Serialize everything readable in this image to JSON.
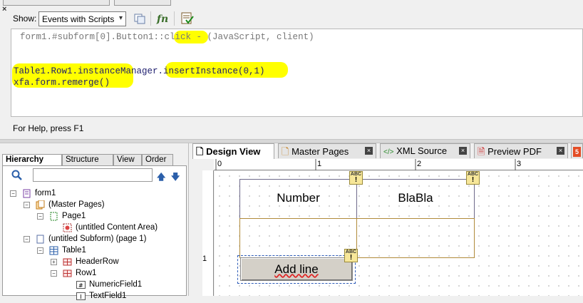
{
  "script_editor": {
    "close_label": "×",
    "show_label": "Show:",
    "show_value": "Events with Scripts",
    "script_header": "form1.#subform[0].Button1::click - (JavaScript, client)",
    "code_lines": [
      "Table1.Row1.instanceManager.insertInstance(0,1)",
      "xfa.form.remerge()"
    ],
    "help_text": "For Help, press F1",
    "highlight_color": "#ffff00"
  },
  "hierarchy_panel": {
    "tabs": [
      "Hierarchy",
      "Structure",
      "View",
      "Order"
    ],
    "tree": [
      {
        "label": "form1",
        "icon": "form-icon",
        "expander": "minus"
      },
      {
        "label": "(Master Pages)",
        "icon": "master-pages-icon",
        "expander": "minus"
      },
      {
        "label": "Page1",
        "icon": "page-icon",
        "expander": "minus"
      },
      {
        "label": "(untitled Content Area)",
        "icon": "content-area-icon",
        "expander": ""
      },
      {
        "label": "(untitled Subform) (page 1)",
        "icon": "subform-icon",
        "expander": "minus"
      },
      {
        "label": "Table1",
        "icon": "table-icon",
        "expander": "minus"
      },
      {
        "label": "HeaderRow",
        "icon": "row-icon",
        "expander": "plus"
      },
      {
        "label": "Row1",
        "icon": "row-icon",
        "expander": "minus"
      },
      {
        "label": "NumericField1",
        "icon": "numeric-field-icon",
        "expander": ""
      },
      {
        "label": "TextField1",
        "icon": "text-field-icon",
        "expander": ""
      }
    ]
  },
  "design_area": {
    "tabs": [
      "Design View",
      "Master Pages",
      "XML Source",
      "Preview PDF"
    ],
    "ruler_labels": [
      "0",
      "1",
      "2",
      "3"
    ],
    "vertical_ruler_label": "1",
    "table_headers": [
      "Number",
      "BlaBla"
    ],
    "button_label": "Add line",
    "icon_badge_text": "ABC"
  }
}
